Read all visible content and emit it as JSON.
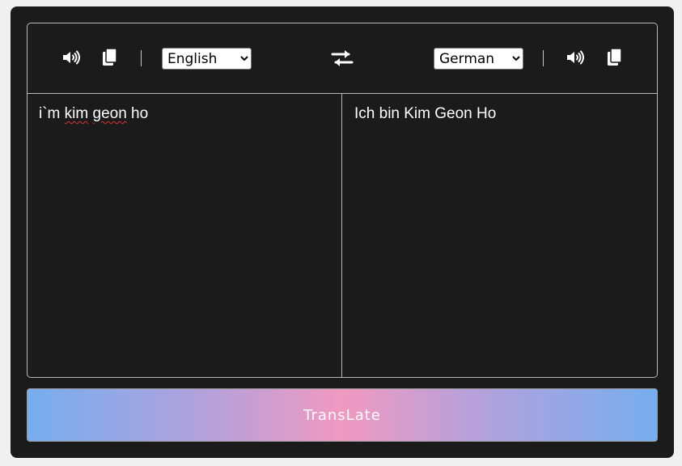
{
  "from": {
    "language": "English",
    "language_options": [
      "English"
    ],
    "text_before": "i`m ",
    "text_misspelled_1": "kim",
    "text_between": " ",
    "text_misspelled_2": "geon",
    "text_after": " ho"
  },
  "to": {
    "language": "German",
    "language_options": [
      "German"
    ],
    "text": "Ich bin Kim Geon Ho"
  },
  "icons": {
    "from_speak": "speaker-icon",
    "from_copy": "copy-icon",
    "exchange": "exchange-icon",
    "to_speak": "speaker-icon",
    "to_copy": "copy-icon"
  },
  "colors": {
    "background": "#1b1b1b",
    "page": "#f0f0f0",
    "border": "#b8b8b8",
    "gradient_edge": "#76aeef",
    "gradient_center": "#f199c0"
  },
  "translate_button": {
    "label": "TransLate"
  }
}
